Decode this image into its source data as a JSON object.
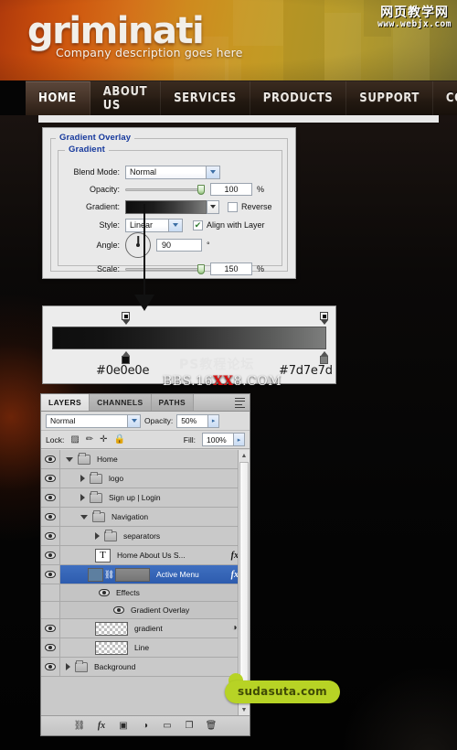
{
  "header": {
    "logo": "griminati",
    "tagline": "Company description goes here",
    "watermark": {
      "cn": "网页教学网",
      "en": "www.webjx.com"
    }
  },
  "nav": {
    "items": [
      {
        "label": "HOME",
        "active": true
      },
      {
        "label": "ABOUT US",
        "active": false
      },
      {
        "label": "SERVICES",
        "active": false
      },
      {
        "label": "PRODUCTS",
        "active": false
      },
      {
        "label": "SUPPORT",
        "active": false
      },
      {
        "label": "CONTACT",
        "active": false
      }
    ]
  },
  "dialog": {
    "title": "Gradient Overlay",
    "group_title": "Gradient",
    "blend_mode_label": "Blend Mode:",
    "blend_mode_value": "Normal",
    "opacity_label": "Opacity:",
    "opacity_value": "100",
    "opacity_unit": "%",
    "gradient_label": "Gradient:",
    "reverse_label": "Reverse",
    "style_label": "Style:",
    "style_value": "Linear",
    "align_label": "Align with Layer",
    "angle_label": "Angle:",
    "angle_value": "90",
    "angle_unit": "°",
    "scale_label": "Scale:",
    "scale_value": "150",
    "scale_unit": "%"
  },
  "gradient_editor": {
    "stop_left_hex": "#0e0e0e",
    "stop_right_hex": "#7d7e7d"
  },
  "center_watermark": {
    "line1": "PS教程论坛",
    "line2_a": "BBS.16",
    "line2_red": "XX",
    "line2_b": "8.COM"
  },
  "layers_panel": {
    "tabs": [
      {
        "label": "LAYERS",
        "active": true
      },
      {
        "label": "CHANNELS",
        "active": false
      },
      {
        "label": "PATHS",
        "active": false
      }
    ],
    "blend_mode": "Normal",
    "opacity_label": "Opacity:",
    "opacity_value": "50%",
    "lock_label": "Lock:",
    "fill_label": "Fill:",
    "fill_value": "100%",
    "rows": [
      {
        "name": "Home",
        "type": "group-open",
        "indent": 0
      },
      {
        "name": "logo",
        "type": "group",
        "indent": 1
      },
      {
        "name": "Sign up  |  Login",
        "type": "group",
        "indent": 1
      },
      {
        "name": "Navigation",
        "type": "group-open",
        "indent": 1
      },
      {
        "name": "separators",
        "type": "group",
        "indent": 2
      },
      {
        "name": "Home    About Us    S...",
        "type": "text",
        "indent": 2,
        "fx": "fx"
      },
      {
        "name": "Active Menu",
        "type": "layer-sel",
        "indent": 2,
        "fx": "fx"
      },
      {
        "name": "Effects",
        "type": "effects",
        "indent": 3
      },
      {
        "name": "Gradient Overlay",
        "type": "effect-item",
        "indent": 4
      },
      {
        "name": "gradient",
        "type": "layer",
        "indent": 2
      },
      {
        "name": "Line",
        "type": "layer",
        "indent": 2
      },
      {
        "name": "Background",
        "type": "group",
        "indent": 0
      }
    ],
    "footer_icons": [
      "link-icon",
      "fx-icon",
      "layer-mask-icon",
      "adjustment-layer-icon",
      "new-group-icon",
      "new-layer-icon",
      "delete-layer-icon"
    ]
  },
  "badge": {
    "text": "sudasuta.com"
  }
}
